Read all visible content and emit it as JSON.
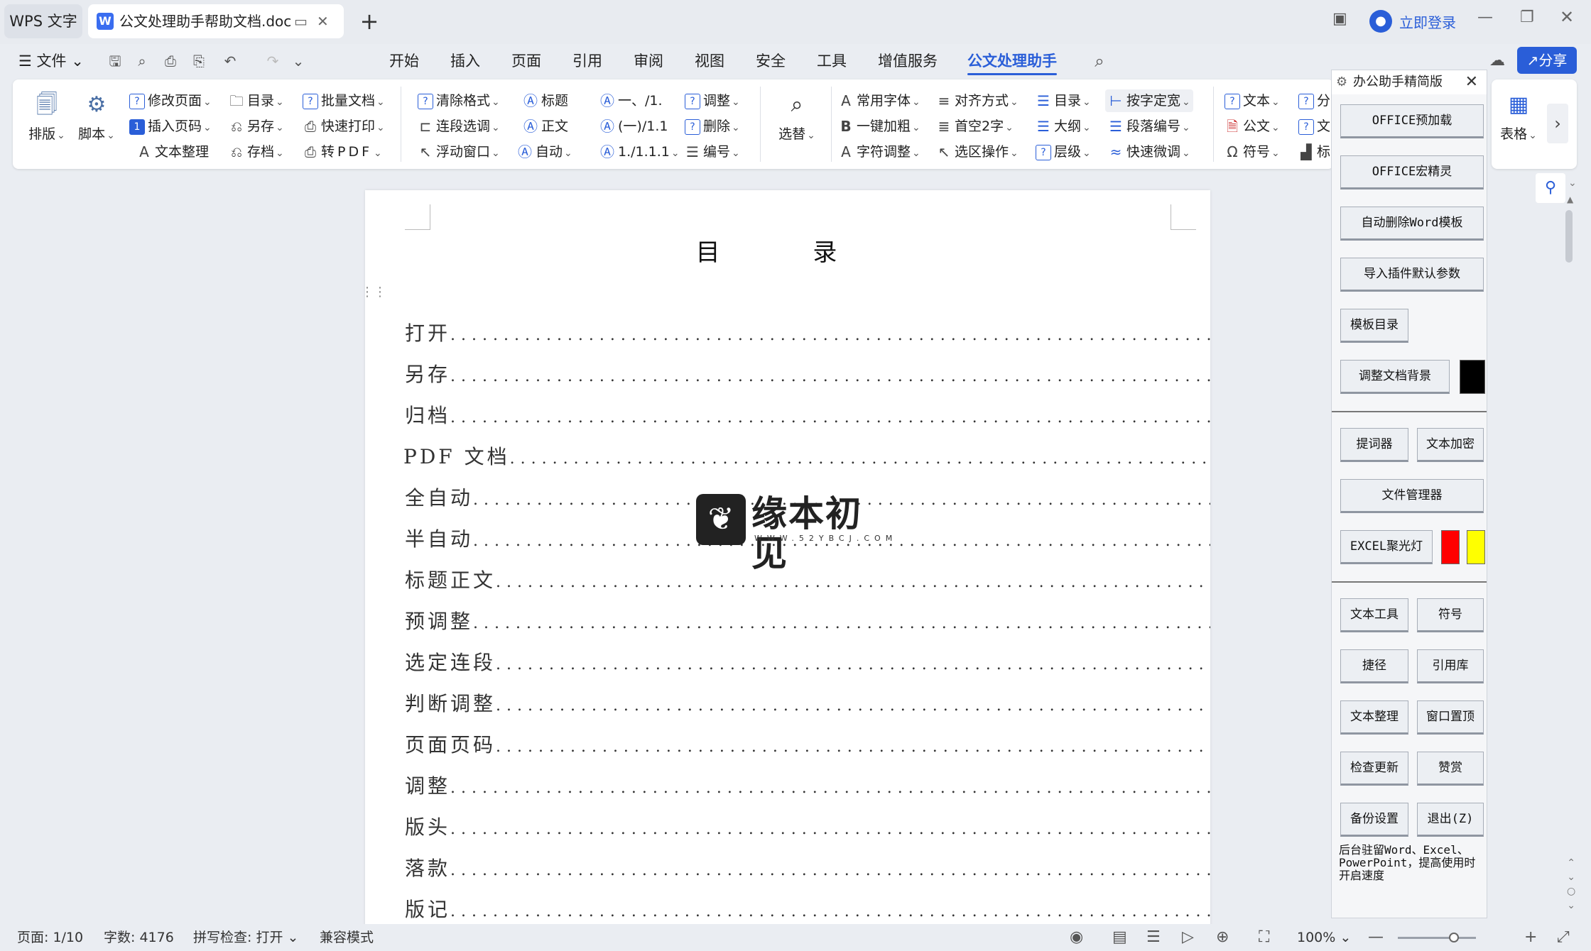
{
  "titlebar": {
    "app_tab": "WPS 文字",
    "doc_tab": "公文处理助手帮助文档.doc",
    "login": "立即登录"
  },
  "menubar": {
    "file": "文件",
    "items": [
      "开始",
      "插入",
      "页面",
      "引用",
      "审阅",
      "视图",
      "安全",
      "工具",
      "增值服务",
      "公文处理助手"
    ],
    "active": "公文处理助手",
    "share": "分享"
  },
  "ribbon": {
    "paiban": "排版",
    "jiaoben": "脚本",
    "col1": [
      "修改页面",
      "插入页码",
      "文本整理"
    ],
    "col2": [
      "目录",
      "另存",
      "存档"
    ],
    "col3": [
      "批量文档",
      "快速打印",
      "转PDF"
    ],
    "col4": [
      "清除格式",
      "连段选调",
      "浮动窗口"
    ],
    "col5": [
      "标题",
      "正文",
      "自动"
    ],
    "col6": [
      "一、/1.",
      "(一)/1.1",
      "1./1.1.1"
    ],
    "col7": [
      "调整",
      "删除",
      "编号"
    ],
    "xuanti": "选替",
    "col8": [
      "常用字体",
      "一键加粗",
      "字符调整"
    ],
    "col9": [
      "对齐方式",
      "首空2字",
      "选区操作"
    ],
    "col10": [
      "目录",
      "大纲",
      "层级"
    ],
    "col11": [
      "按字定宽",
      "段落编号",
      "快速微调"
    ],
    "col12": [
      "文本",
      "公文",
      "符号"
    ],
    "col13": [
      "分",
      "文",
      "标"
    ],
    "biaoge": "表格"
  },
  "document": {
    "title": "目 录",
    "toc": [
      "打开",
      "另存",
      "归档",
      "PDF 文档",
      "全自动",
      "半自动",
      "标题正文",
      "预调整",
      "选定连段",
      "判断调整",
      "页面页码",
      "调整",
      "版头",
      "落款",
      "版记"
    ],
    "dots": "......................................................................................................"
  },
  "watermark": {
    "name": "缘本初见",
    "url": "WWW.52YBCJ.COM"
  },
  "panel": {
    "title": "办公助手精简版",
    "buttons": [
      "OFFICE预加载",
      "OFFICE宏精灵",
      "自动删除Word模板",
      "导入插件默认参数",
      "模板目录",
      "调整文档背景",
      "提词器",
      "文本加密",
      "文件管理器",
      "EXCEL聚光灯",
      "文本工具",
      "符号",
      "捷径",
      "引用库",
      "文本整理",
      "窗口置顶",
      "检查更新",
      "赞赏",
      "备份设置",
      "退出(Z)"
    ],
    "note": "后台驻留Word、Excel、PowerPoint，提高使用时开启速度",
    "colors": {
      "bg": "#000000",
      "red": "#ff0000",
      "yellow": "#ffff00"
    }
  },
  "statusbar": {
    "page": "页面: 1/10",
    "words": "字数: 4176",
    "spell": "拼写检查: 打开",
    "compat": "兼容模式",
    "zoom": "100%"
  },
  "colors": {
    "accent": "#2a5ed8"
  }
}
